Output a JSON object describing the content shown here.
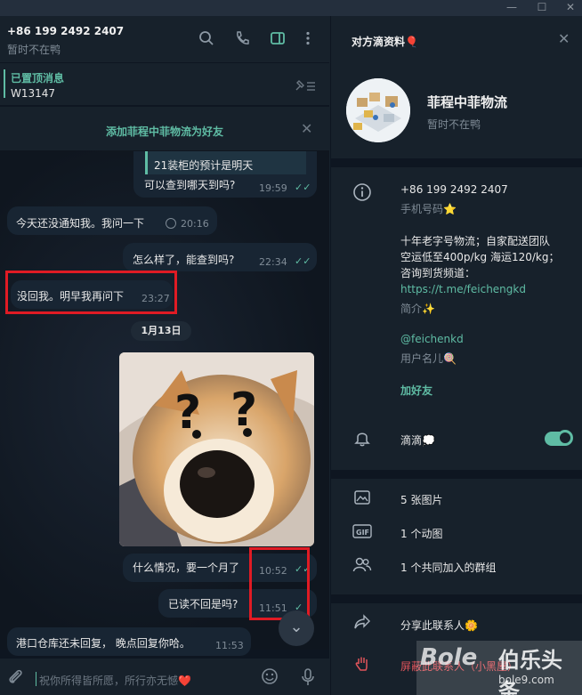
{
  "window": {
    "controls": [
      "—",
      "☐",
      "✕"
    ]
  },
  "chat_header": {
    "title": "+86 199 2492 2407",
    "status": "暂时不在鸭",
    "icons": [
      "search-icon",
      "phone-icon",
      "sidebar-toggle-icon",
      "more-icon"
    ]
  },
  "pinned": {
    "title": "已置顶消息",
    "text": "W13147"
  },
  "add_contact": {
    "label": "添加菲程中菲物流为好友"
  },
  "messages": [
    {
      "quote": "21装柜的预计是明天",
      "text": "可以查到哪天到吗?",
      "time": "19:59",
      "direction": "in",
      "read": true
    },
    {
      "text": "今天还没通知我。我问一下",
      "time": "20:16",
      "direction": "in",
      "read": false
    },
    {
      "text": "怎么样了，能查到吗?",
      "time": "22:34",
      "direction": "in",
      "read": true
    },
    {
      "text": "没回我。明早我再问下",
      "time": "23:27",
      "direction": "in",
      "read": false,
      "highlighted": true
    },
    {
      "text": "什么情况，要一个月了",
      "time": "10:52",
      "direction": "in",
      "read": true,
      "highlighted": true
    },
    {
      "text": "已读不回是吗?",
      "time": "11:51",
      "direction": "in",
      "read": true,
      "highlighted": true
    },
    {
      "text": "港口仓库还未回复， 晚点回复你哈。",
      "time": "11:53",
      "direction": "in",
      "read": false
    }
  ],
  "date_chip": "1月13日",
  "composer": {
    "placeholder": "祝你所得皆所愿，所行亦无憾❤️"
  },
  "profile": {
    "panel_title": "对方滴资料🎈",
    "name": "菲程中菲物流",
    "status": "暂时不在鸭",
    "phone": "+86 199 2492 2407",
    "phone_label": "手机号码⭐",
    "bio_lines": [
      "十年老字号物流；自家配送团队",
      "空运低至400p/kg 海运120/kg；",
      "咨询到货频道："
    ],
    "bio_link": "https://t.me/feichengkd",
    "bio_label": "简介✨",
    "username": "@feichenkd",
    "username_label": "用户名儿🍭",
    "add_friend": "加好友",
    "notifications_label": "滴滴💭",
    "notifications_on": true,
    "media": [
      {
        "icon": "photo-icon",
        "label": "5 张图片"
      },
      {
        "icon": "gif-icon",
        "label": "1 个动图"
      },
      {
        "icon": "group-icon",
        "label": "1 个共同加入的群组"
      }
    ],
    "share_label": "分享此联系人🌼",
    "block_label": "屏蔽此联系人（小黑屋）"
  },
  "watermark": {
    "logo": "Bole",
    "cn": "伯乐头条",
    "url": "bole9.com"
  },
  "colors": {
    "accent": "#5fbca4",
    "highlight_box": "#e01b24",
    "panel_bg": "#17212b",
    "chat_bg": "#0e1621"
  }
}
